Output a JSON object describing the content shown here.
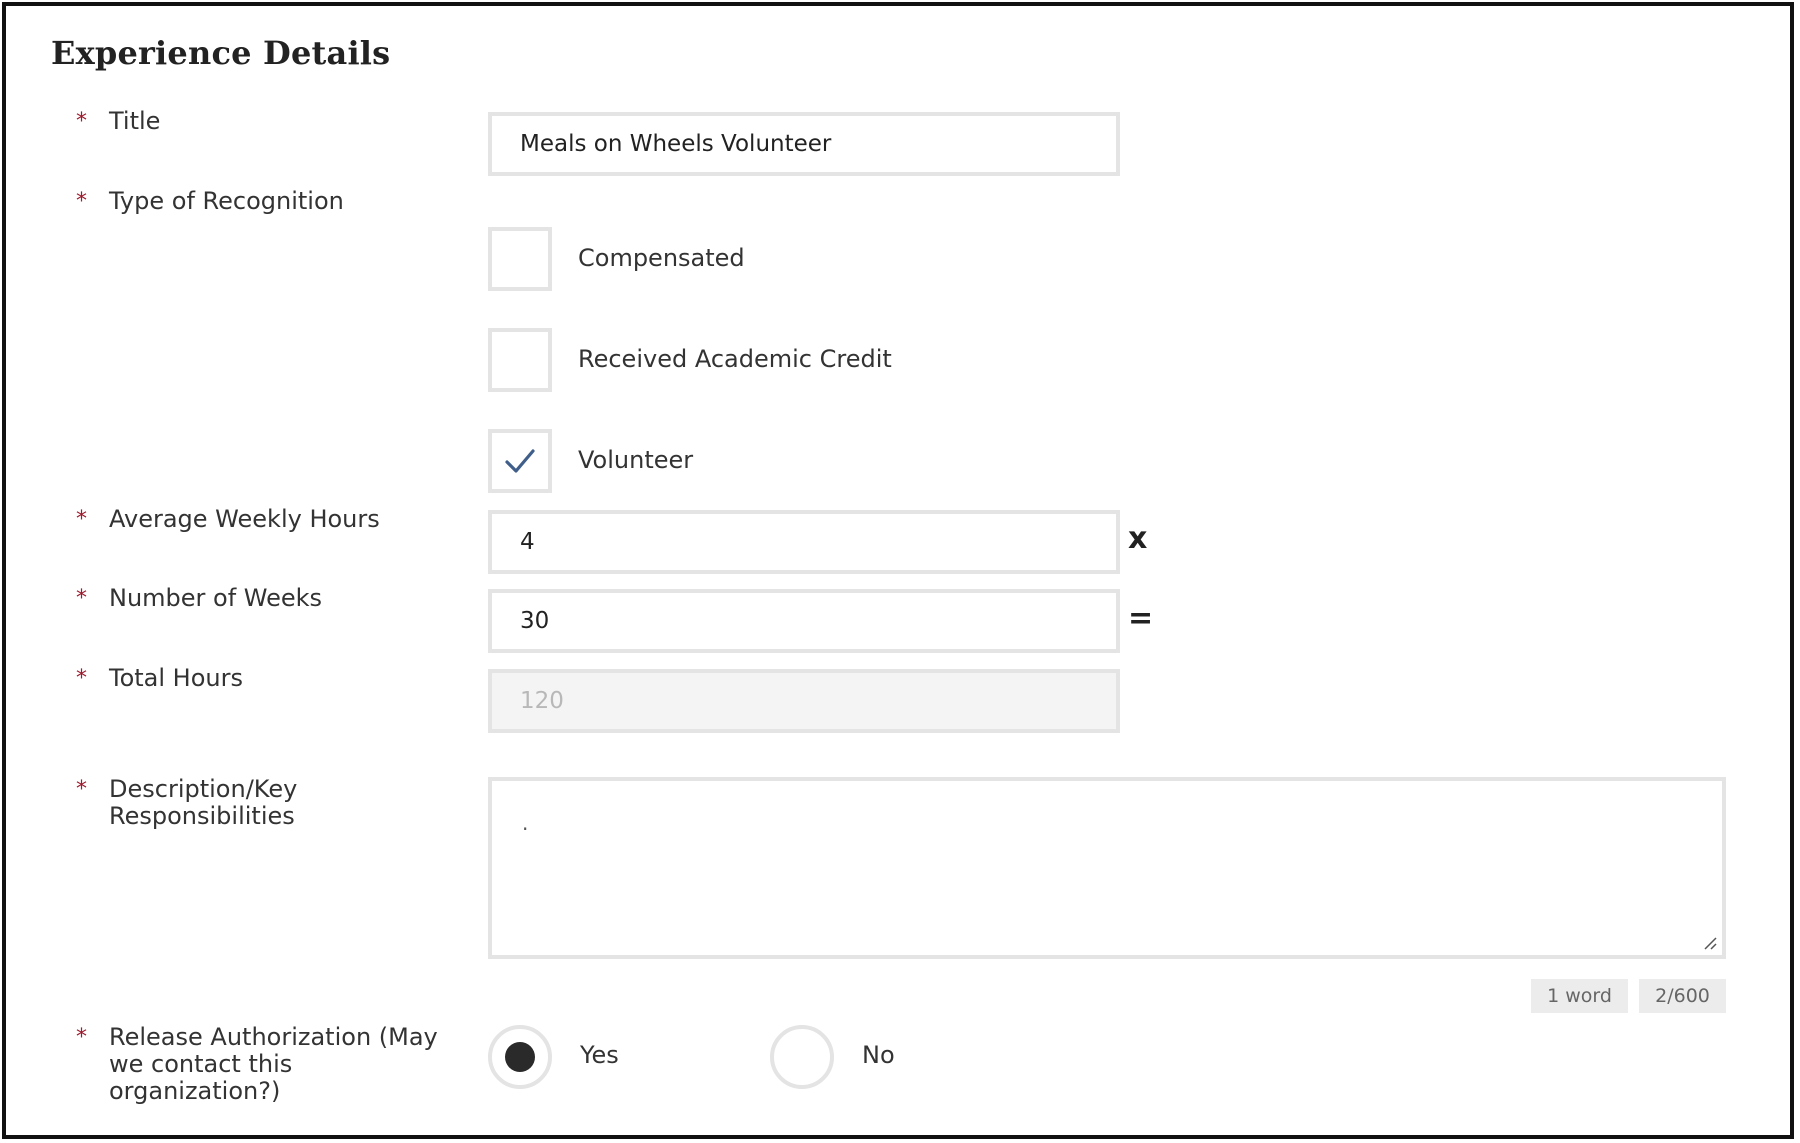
{
  "section": {
    "title": "Experience Details"
  },
  "required_marker": "*",
  "fields": {
    "title": {
      "label": "Title",
      "value": "Meals on Wheels Volunteer"
    },
    "recognition": {
      "label": "Type of Recognition",
      "options": [
        {
          "label": "Compensated",
          "checked": false
        },
        {
          "label": "Received Academic Credit",
          "checked": false
        },
        {
          "label": "Volunteer",
          "checked": true
        }
      ]
    },
    "weekly_hours": {
      "label": "Average Weekly Hours",
      "value": "4",
      "operator": "x"
    },
    "weeks": {
      "label": "Number of Weeks",
      "value": "30",
      "operator": "="
    },
    "total_hours": {
      "label": "Total Hours",
      "value": "120"
    },
    "description": {
      "label": "Description/Key Responsibilities",
      "value": ".",
      "word_count": "1 word",
      "char_count": "2/600"
    },
    "release": {
      "label": "Release Authorization (May we contact this organization?)",
      "options": [
        {
          "label": "Yes",
          "selected": true
        },
        {
          "label": "No",
          "selected": false
        }
      ]
    }
  },
  "colors": {
    "required": "#9b1c2e",
    "check": "#3f5f8a",
    "border": "#e4e4e4"
  },
  "icons": {
    "check": "checkmark-icon",
    "resize": "resize-handle-icon"
  }
}
